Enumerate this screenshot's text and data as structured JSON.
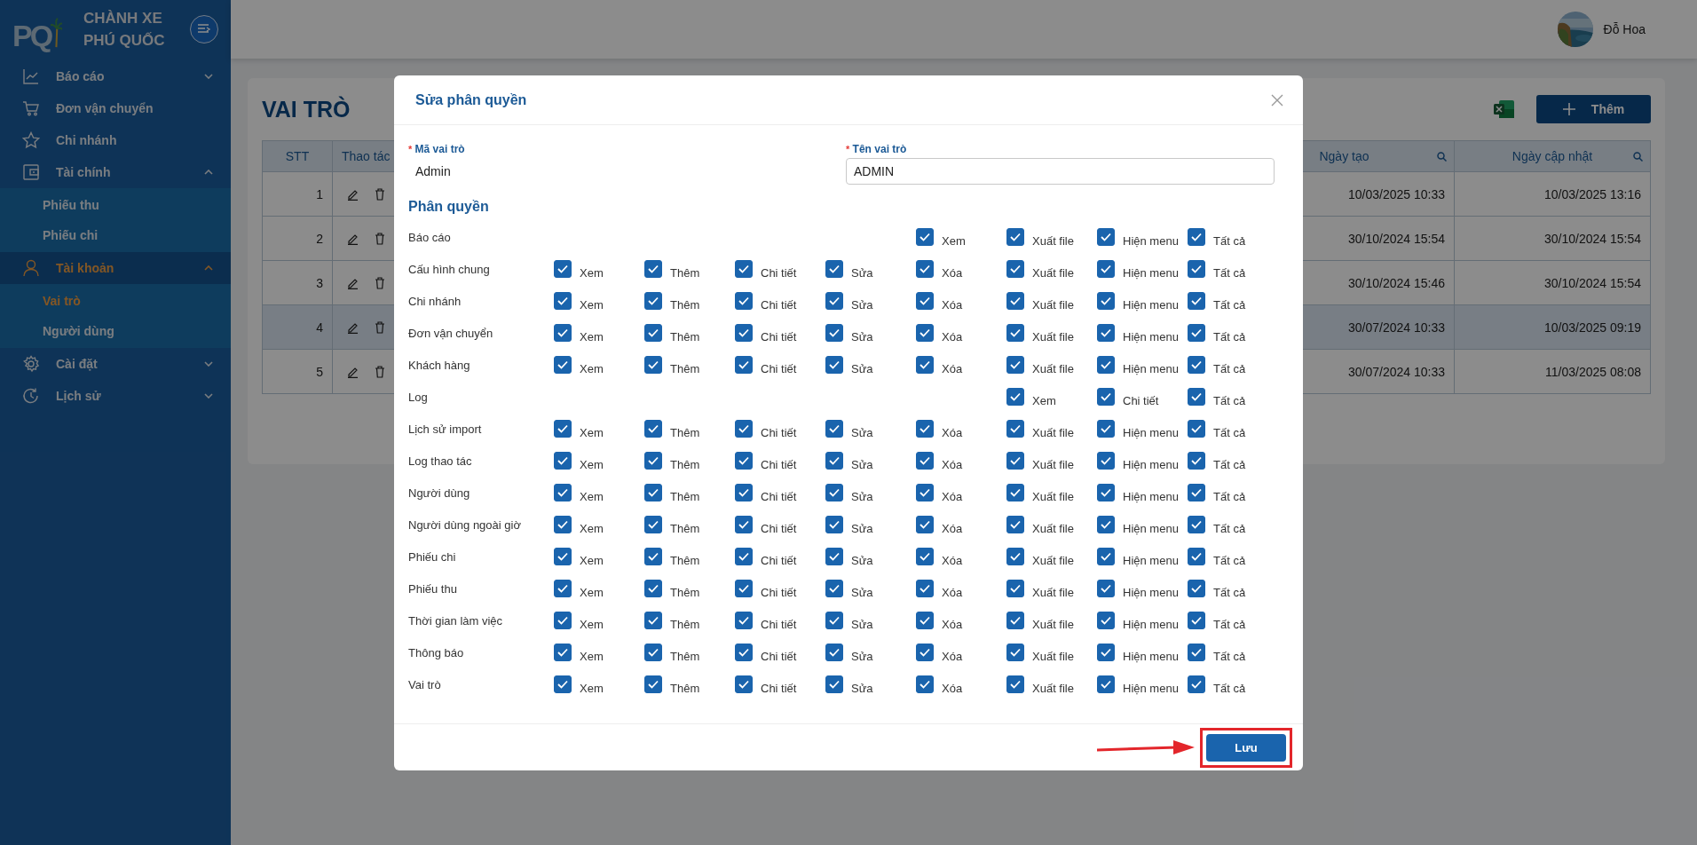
{
  "sidebar": {
    "logo_text": "PQ",
    "brand": [
      "CHÀNH XE",
      "PHÚ QUỐC"
    ],
    "items": [
      {
        "label": "Báo cáo",
        "selected": false,
        "expanded": false
      },
      {
        "label": "Đơn vận chuyển",
        "selected": false
      },
      {
        "label": "Chi nhánh",
        "selected": false
      },
      {
        "label": "Tài chính",
        "selected": false,
        "expanded": true,
        "children": [
          {
            "label": "Phiếu thu",
            "selected": false
          },
          {
            "label": "Phiếu chi",
            "selected": false
          }
        ]
      },
      {
        "label": "Tài khoản",
        "selected": true,
        "expanded": true,
        "children": [
          {
            "label": "Vai trò",
            "selected": true
          },
          {
            "label": "Người dùng",
            "selected": false
          }
        ]
      },
      {
        "label": "Cài đặt",
        "selected": false,
        "expanded": false
      },
      {
        "label": "Lịch sử",
        "selected": false,
        "expanded": false
      }
    ]
  },
  "header": {
    "user_name": "Đỗ Hoa"
  },
  "page": {
    "title": "VAI TRÒ",
    "add_button": "Thêm",
    "table": {
      "columns": [
        {
          "label": "STT"
        },
        {
          "label": "Thao tác"
        },
        {
          "label": "Ngày tạo",
          "searchable": true
        },
        {
          "label": "Ngày cập nhật",
          "searchable": true
        }
      ],
      "rows": [
        {
          "stt": "1",
          "created": "10/03/2025 10:33",
          "updated": "10/03/2025 13:16",
          "selected": false
        },
        {
          "stt": "2",
          "created": "30/10/2024 15:54",
          "updated": "30/10/2024 15:54",
          "selected": false
        },
        {
          "stt": "3",
          "created": "30/10/2024 15:46",
          "updated": "30/10/2024 15:54",
          "selected": false
        },
        {
          "stt": "4",
          "created": "30/07/2024 10:33",
          "updated": "10/03/2025 09:19",
          "selected": true
        },
        {
          "stt": "5",
          "created": "30/07/2024 10:33",
          "updated": "11/03/2025 08:08",
          "selected": false
        }
      ]
    }
  },
  "modal": {
    "title": "Sửa phân quyền",
    "code_field": {
      "required_mark": "*",
      "label": "Mã vai trò",
      "value": "Admin"
    },
    "name_field": {
      "required_mark": "*",
      "label": "Tên vai trò",
      "value": "ADMIN"
    },
    "section_title": "Phân quyền",
    "permission_rows": [
      {
        "name": "Báo cáo",
        "permissions": [
          {
            "label": "Xem",
            "checked": true
          },
          {
            "label": "Xuất file",
            "checked": true
          },
          {
            "label": "Hiện menu",
            "checked": true
          },
          {
            "label": "Tất cả",
            "checked": true
          }
        ]
      },
      {
        "name": "Cấu hình chung",
        "permissions": [
          {
            "label": "Xem",
            "checked": true
          },
          {
            "label": "Thêm",
            "checked": true
          },
          {
            "label": "Chi tiết",
            "checked": true
          },
          {
            "label": "Sửa",
            "checked": true
          },
          {
            "label": "Xóa",
            "checked": true
          },
          {
            "label": "Xuất file",
            "checked": true
          },
          {
            "label": "Hiện menu",
            "checked": true
          },
          {
            "label": "Tất cả",
            "checked": true
          }
        ]
      },
      {
        "name": "Chi nhánh",
        "permissions": [
          {
            "label": "Xem",
            "checked": true
          },
          {
            "label": "Thêm",
            "checked": true
          },
          {
            "label": "Chi tiết",
            "checked": true
          },
          {
            "label": "Sửa",
            "checked": true
          },
          {
            "label": "Xóa",
            "checked": true
          },
          {
            "label": "Xuất file",
            "checked": true
          },
          {
            "label": "Hiện menu",
            "checked": true
          },
          {
            "label": "Tất cả",
            "checked": true
          }
        ]
      },
      {
        "name": "Đơn vận chuyển",
        "permissions": [
          {
            "label": "Xem",
            "checked": true
          },
          {
            "label": "Thêm",
            "checked": true
          },
          {
            "label": "Chi tiết",
            "checked": true
          },
          {
            "label": "Sửa",
            "checked": true
          },
          {
            "label": "Xóa",
            "checked": true
          },
          {
            "label": "Xuất file",
            "checked": true
          },
          {
            "label": "Hiện menu",
            "checked": true
          },
          {
            "label": "Tất cả",
            "checked": true
          }
        ]
      },
      {
        "name": "Khách hàng",
        "permissions": [
          {
            "label": "Xem",
            "checked": true
          },
          {
            "label": "Thêm",
            "checked": true
          },
          {
            "label": "Chi tiết",
            "checked": true
          },
          {
            "label": "Sửa",
            "checked": true
          },
          {
            "label": "Xóa",
            "checked": true
          },
          {
            "label": "Xuất file",
            "checked": true
          },
          {
            "label": "Hiện menu",
            "checked": true
          },
          {
            "label": "Tất cả",
            "checked": true
          }
        ]
      },
      {
        "name": "Log",
        "permissions": [
          {
            "label": "Xem",
            "checked": true
          },
          {
            "label": "Chi tiết",
            "checked": true
          },
          {
            "label": "Tất cả",
            "checked": true
          }
        ]
      },
      {
        "name": "Lịch sử import",
        "permissions": [
          {
            "label": "Xem",
            "checked": true
          },
          {
            "label": "Thêm",
            "checked": true
          },
          {
            "label": "Chi tiết",
            "checked": true
          },
          {
            "label": "Sửa",
            "checked": true
          },
          {
            "label": "Xóa",
            "checked": true
          },
          {
            "label": "Xuất file",
            "checked": true
          },
          {
            "label": "Hiện menu",
            "checked": true
          },
          {
            "label": "Tất cả",
            "checked": true
          }
        ]
      },
      {
        "name": "Log thao tác",
        "permissions": [
          {
            "label": "Xem",
            "checked": true
          },
          {
            "label": "Thêm",
            "checked": true
          },
          {
            "label": "Chi tiết",
            "checked": true
          },
          {
            "label": "Sửa",
            "checked": true
          },
          {
            "label": "Xóa",
            "checked": true
          },
          {
            "label": "Xuất file",
            "checked": true
          },
          {
            "label": "Hiện menu",
            "checked": true
          },
          {
            "label": "Tất cả",
            "checked": true
          }
        ]
      },
      {
        "name": "Người dùng",
        "permissions": [
          {
            "label": "Xem",
            "checked": true
          },
          {
            "label": "Thêm",
            "checked": true
          },
          {
            "label": "Chi tiết",
            "checked": true
          },
          {
            "label": "Sửa",
            "checked": true
          },
          {
            "label": "Xóa",
            "checked": true
          },
          {
            "label": "Xuất file",
            "checked": true
          },
          {
            "label": "Hiện menu",
            "checked": true
          },
          {
            "label": "Tất cả",
            "checked": true
          }
        ]
      },
      {
        "name": "Người dùng ngoài giờ",
        "permissions": [
          {
            "label": "Xem",
            "checked": true
          },
          {
            "label": "Thêm",
            "checked": true
          },
          {
            "label": "Chi tiết",
            "checked": true
          },
          {
            "label": "Sửa",
            "checked": true
          },
          {
            "label": "Xóa",
            "checked": true
          },
          {
            "label": "Xuất file",
            "checked": true
          },
          {
            "label": "Hiện menu",
            "checked": true
          },
          {
            "label": "Tất cả",
            "checked": true
          }
        ]
      },
      {
        "name": "Phiếu chi",
        "permissions": [
          {
            "label": "Xem",
            "checked": true
          },
          {
            "label": "Thêm",
            "checked": true
          },
          {
            "label": "Chi tiết",
            "checked": true
          },
          {
            "label": "Sửa",
            "checked": true
          },
          {
            "label": "Xóa",
            "checked": true
          },
          {
            "label": "Xuất file",
            "checked": true
          },
          {
            "label": "Hiện menu",
            "checked": true
          },
          {
            "label": "Tất cả",
            "checked": true
          }
        ]
      },
      {
        "name": "Phiếu thu",
        "permissions": [
          {
            "label": "Xem",
            "checked": true
          },
          {
            "label": "Thêm",
            "checked": true
          },
          {
            "label": "Chi tiết",
            "checked": true
          },
          {
            "label": "Sửa",
            "checked": true
          },
          {
            "label": "Xóa",
            "checked": true
          },
          {
            "label": "Xuất file",
            "checked": true
          },
          {
            "label": "Hiện menu",
            "checked": true
          },
          {
            "label": "Tất cả",
            "checked": true
          }
        ]
      },
      {
        "name": "Thời gian làm việc",
        "permissions": [
          {
            "label": "Xem",
            "checked": true
          },
          {
            "label": "Thêm",
            "checked": true
          },
          {
            "label": "Chi tiết",
            "checked": true
          },
          {
            "label": "Sửa",
            "checked": true
          },
          {
            "label": "Xóa",
            "checked": true
          },
          {
            "label": "Xuất file",
            "checked": true
          },
          {
            "label": "Hiện menu",
            "checked": true
          },
          {
            "label": "Tất cả",
            "checked": true
          }
        ]
      },
      {
        "name": "Thông báo",
        "permissions": [
          {
            "label": "Xem",
            "checked": true
          },
          {
            "label": "Thêm",
            "checked": true
          },
          {
            "label": "Chi tiết",
            "checked": true
          },
          {
            "label": "Sửa",
            "checked": true
          },
          {
            "label": "Xóa",
            "checked": true
          },
          {
            "label": "Xuất file",
            "checked": true
          },
          {
            "label": "Hiện menu",
            "checked": true
          },
          {
            "label": "Tất cả",
            "checked": true
          }
        ]
      },
      {
        "name": "Vai trò",
        "permissions": [
          {
            "label": "Xem",
            "checked": true
          },
          {
            "label": "Thêm",
            "checked": true
          },
          {
            "label": "Chi tiết",
            "checked": true
          },
          {
            "label": "Sửa",
            "checked": true
          },
          {
            "label": "Xóa",
            "checked": true
          },
          {
            "label": "Xuất file",
            "checked": true
          },
          {
            "label": "Hiện menu",
            "checked": true
          },
          {
            "label": "Tất cả",
            "checked": true
          }
        ]
      }
    ],
    "save_button": "Lưu"
  }
}
